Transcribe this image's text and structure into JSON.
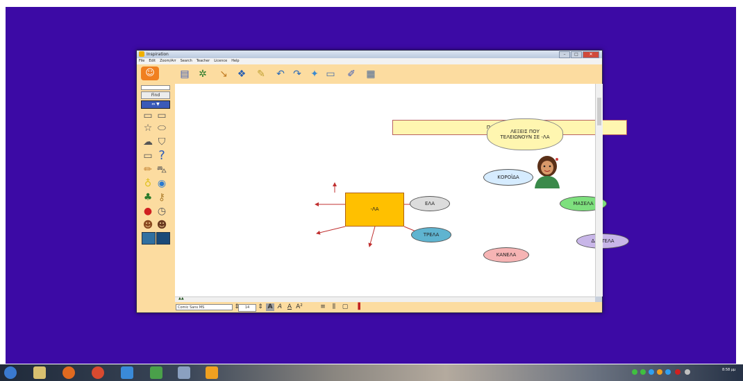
{
  "window": {
    "title": "Inspiration",
    "minimize": "–",
    "maximize": "□",
    "close": "✕"
  },
  "menu": [
    "File",
    "Edit",
    "Zoom/Arr",
    "Search",
    "Teacher",
    "Licence",
    "Help"
  ],
  "toolbar": {
    "icons": [
      "doc-icon",
      "spider-icon",
      "link-icon",
      "arrange-icon",
      "pencil-icon",
      "undo-icon",
      "redo-icon",
      "idea-icon",
      "note-icon",
      "pen-icon",
      "outline-icon"
    ]
  },
  "left_panel": {
    "find_label": "Find",
    "nav_label": "⇔ ▼"
  },
  "diagram": {
    "title_box": "ΠΑΙΔΙΚΑ ΠΑΙΧΝΙΔΙΑ",
    "cloud": "ΛΕΞΕΙΣ ΠΟΥ ΤΕΛΕΙΩΝΟΥΝ ΣΕ -ΛΑ",
    "center": "-ΛΑ",
    "nodes": {
      "top": "ΚΟΡΟΪΔΑ",
      "left": "ΕΛΑ",
      "right": "ΜΑΣΕΛΑ",
      "left_bottom": "ΤΡΕΛΑ",
      "bottom": "ΚΑΝΕΛΑ",
      "right_bottom": "ΔΑΝΤΕΛΑ"
    }
  },
  "status": {
    "font": "Comic Sans MS",
    "size": "14",
    "zoom": "▲▲"
  },
  "taskbar": {
    "clock": "8:58 μμ"
  }
}
